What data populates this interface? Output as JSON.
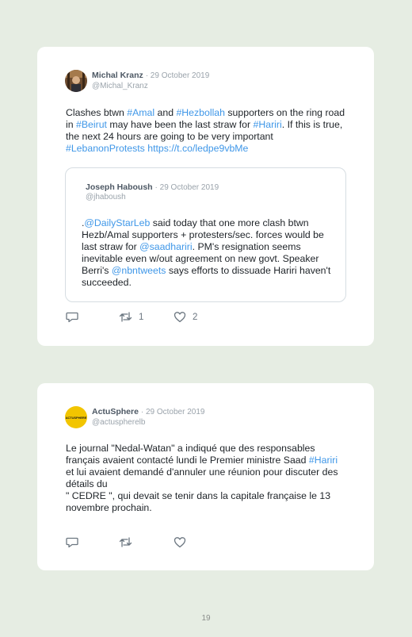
{
  "tweets": [
    {
      "name": "Michal Kranz",
      "date": "· 29 October 2019",
      "handle": "@Michal_Kranz",
      "body": [
        {
          "t": "Clashes btwn ",
          "link": false
        },
        {
          "t": "#Amal",
          "link": true
        },
        {
          "t": " and ",
          "link": false
        },
        {
          "t": "#Hezbollah",
          "link": true
        },
        {
          "t": " supporters on the ring road in ",
          "link": false
        },
        {
          "t": "#Beirut",
          "link": true
        },
        {
          "t": " may have been the last straw for ",
          "link": false
        },
        {
          "t": "#Hariri",
          "link": true
        },
        {
          "t": ". If this is true, the next 24 hours are going to be very important ",
          "link": false
        },
        {
          "t": "#LebanonProtests",
          "link": true
        },
        {
          "t": " ",
          "link": false
        },
        {
          "t": "https://t.co/ledpe9vbMe",
          "link": true
        }
      ],
      "quote": {
        "name": "Joseph Haboush",
        "date": "· 29 October 2019",
        "handle": "@jhaboush",
        "body": [
          {
            "t": ".",
            "link": false
          },
          {
            "t": "@DailyStarLeb",
            "link": true
          },
          {
            "t": " said today that one more clash btwn Hezb/Amal supporters + protesters/sec. forces would be last straw for ",
            "link": false
          },
          {
            "t": "@saadhariri",
            "link": true
          },
          {
            "t": ". PM's resignation seems inevitable even w/out agreement on new govt. Speaker Berri's ",
            "link": false
          },
          {
            "t": "@nbntweets",
            "link": true
          },
          {
            "t": " says efforts to dissuade Hariri haven't succeeded.",
            "link": false
          }
        ]
      },
      "retweets": "1",
      "likes": "2"
    },
    {
      "name": "ActuSphere",
      "date": "· 29 October 2019",
      "handle": "@actuspherelb",
      "avatar_text": "ACTUSPHERE",
      "body": [
        {
          "t": "Le journal \"Nedal-Watan\" a indiqué que des responsables français avaient contacté lundi le Premier ministre Saad ",
          "link": false
        },
        {
          "t": "#Hariri",
          "link": true
        },
        {
          "t": " et lui avaient demandé d'annuler une réunion pour discuter des détails du\n\" CEDRE \", qui devait se tenir dans la capitale française le 13 novembre prochain.",
          "link": false
        }
      ],
      "retweets": "",
      "likes": ""
    }
  ],
  "page_number": "19",
  "colors": {
    "link": "#3f97e8",
    "background": "#e6ede3",
    "avatar_yellow": "#f2c500"
  }
}
